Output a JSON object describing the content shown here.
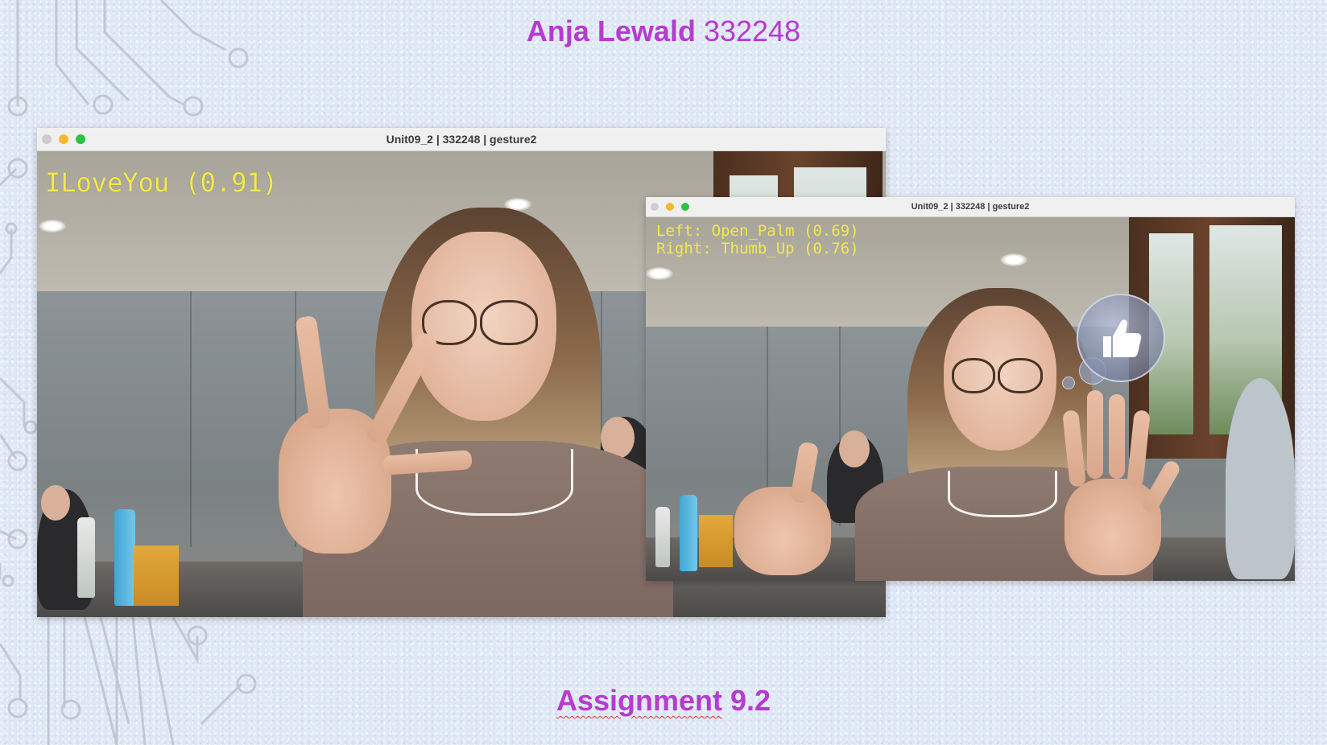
{
  "slide": {
    "title_name": "Anja Lewald",
    "title_id": "332248",
    "subtitle_word": "Assignment",
    "subtitle_number": "9.2"
  },
  "window_main": {
    "title": "Unit09_2 | 332248 | gesture2",
    "overlay": "ILoveYou (0.91)"
  },
  "window_second": {
    "title": "Unit09_2 | 332248 | gesture2",
    "overlay_left": "Left: Open_Palm (0.69)",
    "overlay_right": "Right: Thumb_Up (0.76)",
    "emoji_icon": "thumbs-up-icon"
  },
  "colors": {
    "title_purple": "#b63bd0",
    "overlay_yellow": "#f5e94a",
    "traffic_red_inactive": "#cdcdcd",
    "traffic_yellow": "#f5b92c",
    "traffic_green": "#2dc146"
  }
}
